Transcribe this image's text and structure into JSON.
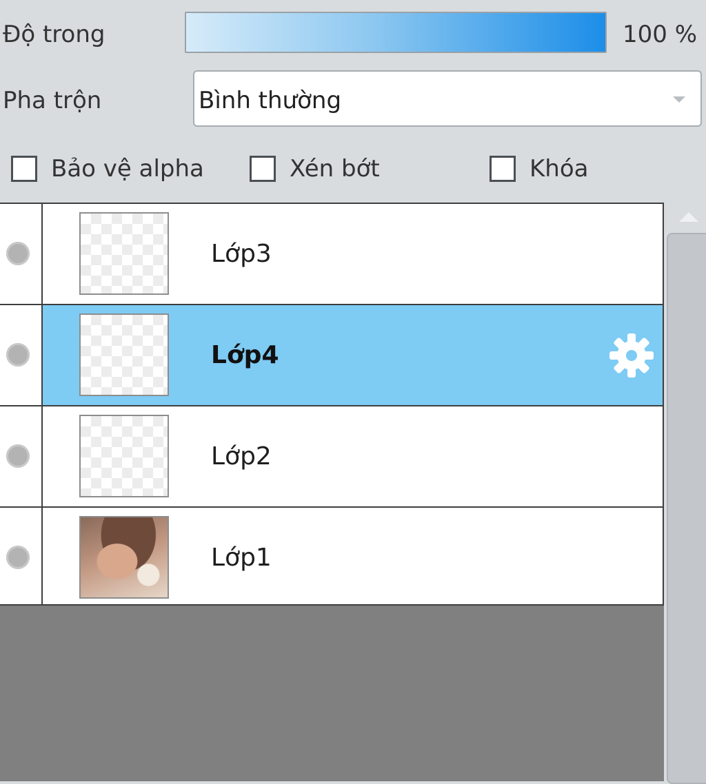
{
  "opacity": {
    "label": "Độ trong",
    "value_text": "100 %",
    "value": 100
  },
  "blend": {
    "label": "Pha trộn",
    "value": "Bình thường"
  },
  "checkboxes": {
    "protect_alpha": {
      "label": "Bảo vệ alpha",
      "checked": false
    },
    "clip": {
      "label": "Xén bớt",
      "checked": false
    },
    "lock": {
      "label": "Khóa",
      "checked": false
    }
  },
  "layers": [
    {
      "name": "Lớp3",
      "selected": false,
      "thumbnail": "transparent"
    },
    {
      "name": "Lớp4",
      "selected": true,
      "thumbnail": "transparent",
      "icon": "gear-icon"
    },
    {
      "name": "Lớp2",
      "selected": false,
      "thumbnail": "transparent"
    },
    {
      "name": "Lớp1",
      "selected": false,
      "thumbnail": "photo"
    }
  ],
  "colors": {
    "selected_row": "#7ecbf4",
    "opacity_fill_end": "#1c8ee8",
    "panel_background": "#808080"
  }
}
